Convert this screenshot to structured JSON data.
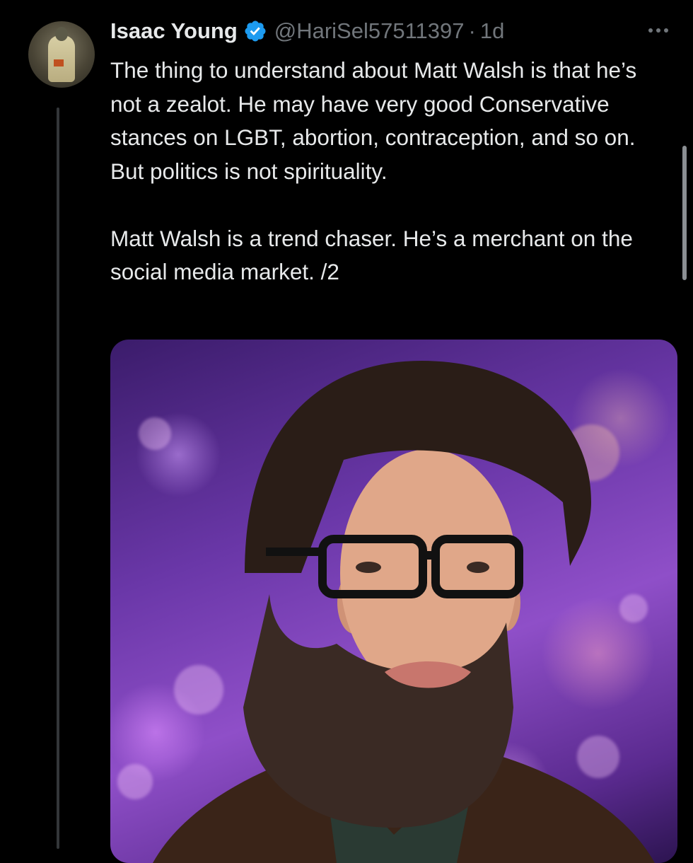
{
  "tweet": {
    "display_name": "Isaac Young",
    "handle": "@HariSel57511397",
    "separator": "·",
    "time": "1d",
    "paragraphs": [
      "The thing to understand about Matt Walsh is that he’s not a zealot. He may have very good Conservative stances on LGBT, abortion, contraception, and so on. But politics is not spirituality.",
      "Matt Walsh is a trend chaser. He’s a merchant on the social media market. /2"
    ],
    "avatar_icon": "avatar-image",
    "verified_icon": "verified-badge-icon",
    "more_icon": "more-options-icon",
    "media_icon": "photo-attachment"
  },
  "colors": {
    "background": "#000000",
    "text_primary": "#e7e9ea",
    "text_secondary": "#71767b",
    "verified_blue": "#1d9bf0",
    "thread_line": "#333639"
  }
}
